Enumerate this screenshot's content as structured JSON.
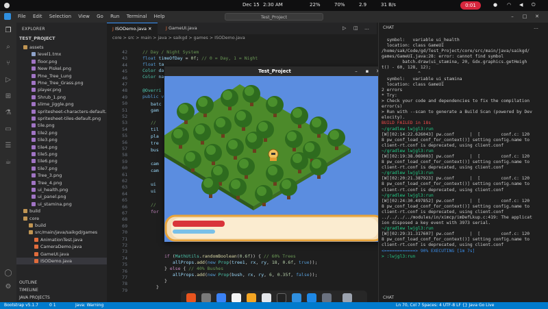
{
  "topbar": {
    "date": "Dec 15",
    "time": "2:30 AM",
    "battery": "22%",
    "cpu": "70%",
    "mem": "2.9",
    "net": "31 B/s",
    "rec": "0:01"
  },
  "vscode": {
    "menu": [
      "File",
      "Edit",
      "Selection",
      "View",
      "Go",
      "Run",
      "Terminal",
      "Help"
    ],
    "search": "Test_Project"
  },
  "explorer": {
    "header": "EXPLORER",
    "project": "TEST_PROJECT",
    "items": [
      {
        "label": "assets",
        "kind": "folder"
      },
      {
        "label": "level1.tmx",
        "kind": "file"
      },
      {
        "label": "floor.png",
        "kind": "png"
      },
      {
        "label": "New Piskel.png",
        "kind": "png"
      },
      {
        "label": "Pine_Tree_Lung",
        "kind": "png"
      },
      {
        "label": "Pine_Tree_Grass.png",
        "kind": "png"
      },
      {
        "label": "player.png",
        "kind": "png"
      },
      {
        "label": "Shrub_1.png",
        "kind": "png"
      },
      {
        "label": "slime_jiggle.png",
        "kind": "png"
      },
      {
        "label": "spritesheet-characters-default...",
        "kind": "png"
      },
      {
        "label": "spritesheet-tiles-default.png",
        "kind": "png"
      },
      {
        "label": "tile.png",
        "kind": "png"
      },
      {
        "label": "tile2.png",
        "kind": "png"
      },
      {
        "label": "tile3.png",
        "kind": "png"
      },
      {
        "label": "tile4.png",
        "kind": "png"
      },
      {
        "label": "tile5.png",
        "kind": "png"
      },
      {
        "label": "tile6.png",
        "kind": "png"
      },
      {
        "label": "tile7.png",
        "kind": "png"
      },
      {
        "label": "Tree_3.png",
        "kind": "png"
      },
      {
        "label": "Tree_4.png",
        "kind": "png"
      },
      {
        "label": "ui_health.png",
        "kind": "png"
      },
      {
        "label": "ui_panel.png",
        "kind": "png"
      },
      {
        "label": "ui_stamina.png",
        "kind": "png"
      },
      {
        "label": "build",
        "kind": "folder"
      },
      {
        "label": "core",
        "kind": "folder"
      },
      {
        "label": "build",
        "kind": "folder"
      },
      {
        "label": "src/main/java/saikgd/games",
        "kind": "folder"
      },
      {
        "label": "AnimationTest.java",
        "kind": "java"
      },
      {
        "label": "CameraDemo.java",
        "kind": "java"
      },
      {
        "label": "GameUI.java",
        "kind": "java"
      },
      {
        "label": "ISODemo.java",
        "kind": "java"
      }
    ],
    "sections": [
      "OUTLINE",
      "TIMELINE",
      "JAVA PROJECTS"
    ]
  },
  "editor": {
    "tabs": [
      "ISODemo.java",
      "GameUI.java"
    ],
    "breadcrumb": "core > src > main > java > saikgd > games > ISODemo.java",
    "line_numbers": [
      42,
      43,
      44,
      45,
      46,
      47,
      48,
      49,
      50,
      51,
      52,
      53,
      54,
      55,
      56,
      57,
      58,
      59,
      60,
      61,
      62,
      63,
      64,
      65,
      66,
      67,
      68,
      69,
      70,
      71,
      72,
      73,
      74,
      75,
      76,
      77,
      78,
      79
    ]
  },
  "game": {
    "title": "Test_Project"
  },
  "terminal": {
    "header": "CHAT",
    "lines": [
      "  symbol:   variable ui_health",
      "  location: class GameUI",
      "/home/sak/Code/gd/Test_Project/core/src/main/java/saikgd/",
      "games/GameUI.java:28: error: cannot find symbol",
      "        batch.draw(ui_stamina, 20, Gdx.graphics.getHeigh",
      "t() - 60, 128, 12);",
      "              ^",
      "  symbol:   variable ui_stamina",
      "  location: class GameUI",
      "2 errors",
      "",
      "* Try:",
      "> Check your code and dependencies to fix the compilation",
      "error(s)",
      "> Run with --scan to generate a Build Scan (powered by Dev",
      "elocity).",
      "",
      "BUILD FAILED in 18s",
      "~/gradlew lwjgl3:run",
      "[W][02:14:22.626043] pw.conf      |  [        conf.c: 120",
      "8 pw_conf_load_conf_for_context()] setting config.name to",
      "client-rt.conf is deprecated, using client.conf",
      "~/gradlew lwjgl3:run",
      "[W][02:19:38.069003] pw.conf      |  [        conf.c: 120",
      "8 pw_conf_load_conf_for_context()] setting config.name to",
      "client-rt.conf is deprecated, using client.conf",
      "~/gradlew lwjgl3:run",
      "[W][02:20:21.387923] pw.conf      |  [        conf.c: 120",
      "8 pw_conf_load_conf_for_context()] setting config.name to",
      "client-rt.conf is deprecated, using client.conf",
      "~/gradlew lwjgl3:run",
      "[W][02:24:30.497852] pw.conf      |  [        conf.c: 120",
      "8 pw_conf_load_conf_for_context()] setting config.name to",
      "client-rt.conf is deprecated, using client.conf",
      "../../../../modules/in/ximcp/imDefLkup.c:419: The applicat",
      "ion disposed a key event with 3973 serial.",
      "~/gradlew lwjgl3:run",
      "[W][02:29:31.317607] pw.conf      |  [        conf.c: 120",
      "8 pw_conf_load_conf_for_context()] setting config.name to",
      "client-rt.conf is deprecated, using client.conf",
      "<============> 90% EXECUTING [1m 7s]",
      "> :lwjgl3:run"
    ],
    "footer": "CHAT"
  },
  "status": {
    "left": "Bootstrap v5.1.7",
    "problems": "0  1",
    "java": "Java: Warning",
    "right": "Ln 70, Col 7   Spaces: 4   UTF-8   LF   {} Java   Go Live"
  }
}
